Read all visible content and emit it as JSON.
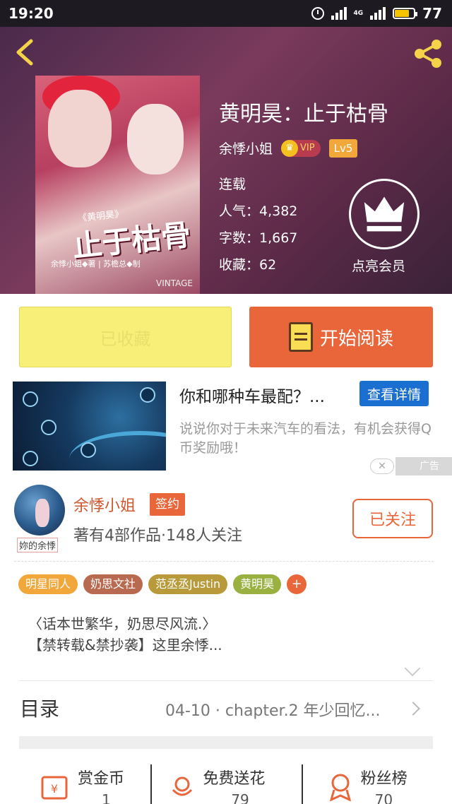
{
  "status_bar": {
    "time": "19:20",
    "network": "4G",
    "battery": "77",
    "battery_level": 0.77
  },
  "book": {
    "title": "黄明昊：止于枯骨",
    "author": "余悸小姐",
    "vip_label": "VIP",
    "level": "Lv5",
    "status": "连载",
    "popularity": "人气：4,382",
    "word_count": "字数：1,667",
    "collections": "收藏：62",
    "member_label": "点亮会员",
    "cover_text": {
      "series": "《黄明昊》",
      "title": "止于枯骨",
      "credit": "余悸小姐◆著 | 苏檐总◆制",
      "vintage": "VINTAGE"
    }
  },
  "actions": {
    "favorited_label": "已收藏",
    "read_label": "开始阅读"
  },
  "ad": {
    "title": "你和哪种车最配？...",
    "button": "查看详情",
    "description": "说说你对于未来汽车的看法，有机会获得Q币奖励哦！",
    "tag": "广告",
    "close": "✕"
  },
  "author_card": {
    "avatar_caption": "妳的余悸",
    "name": "余悸小姐",
    "badge": "签约",
    "stats": "著有4部作品·148人关注",
    "follow_label": "已关注",
    "tags": [
      {
        "label": "明星同人",
        "color": "#f2a73a"
      },
      {
        "label": "奶思文社",
        "color": "#b86a50"
      },
      {
        "label": "范丞丞Justin",
        "color": "#b89a3a"
      },
      {
        "label": "黄明昊",
        "color": "#9ab040"
      }
    ],
    "tag_more": "+",
    "intro_line1": "〈话本世繁华，奶思尽风流.〉",
    "intro_line2": "【禁转载&禁抄袭】这里余悸..."
  },
  "toc": {
    "label": "目录",
    "latest": "04-10 · chapter.2 年少回忆..."
  },
  "bottom_bar": [
    {
      "label": "赏金币",
      "value": "1"
    },
    {
      "label": "免费送花",
      "value": "79"
    },
    {
      "label": "粉丝榜",
      "value": "70"
    }
  ]
}
